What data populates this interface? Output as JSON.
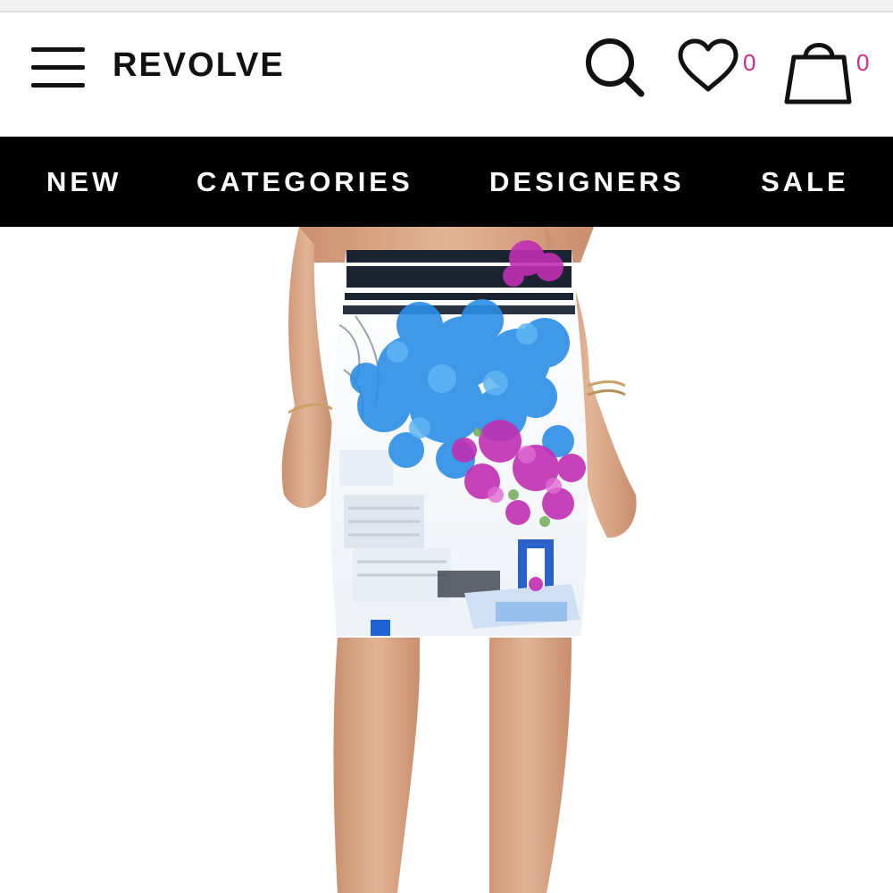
{
  "header": {
    "logo_text": "REVOLVE",
    "wishlist_count": "0",
    "bag_count": "0",
    "icons": [
      "menu-icon",
      "search-icon",
      "heart-icon",
      "shopping-bag-icon"
    ],
    "count_color": "#d4298f"
  },
  "nav": {
    "items": [
      {
        "label": "NEW"
      },
      {
        "label": "CATEGORIES"
      },
      {
        "label": "DESIGNERS"
      },
      {
        "label": "SALE"
      }
    ]
  },
  "colors": {
    "nav_background": "#000000",
    "page_background": "#ffffff",
    "accent": "#d4298f"
  }
}
